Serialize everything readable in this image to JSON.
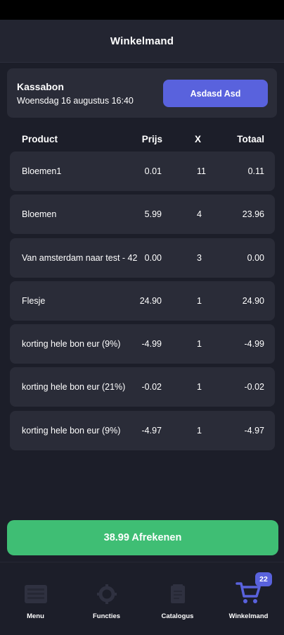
{
  "header": {
    "title": "Winkelmand"
  },
  "receipt": {
    "title": "Kassabon",
    "date": "Woensdag 16 augustus 16:40",
    "customer_button_label": "Asdasd Asd"
  },
  "table": {
    "columns": {
      "product": "Product",
      "price": "Prijs",
      "qty": "X",
      "total": "Totaal"
    },
    "rows": [
      {
        "product": "Bloemen1",
        "price": "0.01",
        "qty": "11",
        "total": "0.11"
      },
      {
        "product": "Bloemen",
        "price": "5.99",
        "qty": "4",
        "total": "23.96"
      },
      {
        "product": "Van amsterdam naar test - 42",
        "price": "0.00",
        "qty": "3",
        "total": "0.00"
      },
      {
        "product": "Flesje",
        "price": "24.90",
        "qty": "1",
        "total": "24.90"
      },
      {
        "product": "korting hele bon eur (9%)",
        "price": "-4.99",
        "qty": "1",
        "total": "-4.99"
      },
      {
        "product": "korting hele bon eur (21%)",
        "price": "-0.02",
        "qty": "1",
        "total": "-0.02"
      },
      {
        "product": "korting hele bon eur (9%)",
        "price": "-4.97",
        "qty": "1",
        "total": "-4.97"
      }
    ]
  },
  "checkout": {
    "label": "38.99 Afrekenen"
  },
  "bottom_nav": {
    "items": [
      {
        "label": "Menu",
        "icon": "menu-icon",
        "active": false
      },
      {
        "label": "Functies",
        "icon": "functions-icon",
        "active": false
      },
      {
        "label": "Catalogus",
        "icon": "catalog-icon",
        "active": false
      },
      {
        "label": "Winkelmand",
        "icon": "cart-icon",
        "active": true
      }
    ],
    "cart_badge": "22"
  },
  "colors": {
    "background": "#1c1e29",
    "card": "#2a2c38",
    "accent": "#5962dd",
    "checkout": "#3fbe74",
    "inactive_icon": "#2f3140"
  }
}
